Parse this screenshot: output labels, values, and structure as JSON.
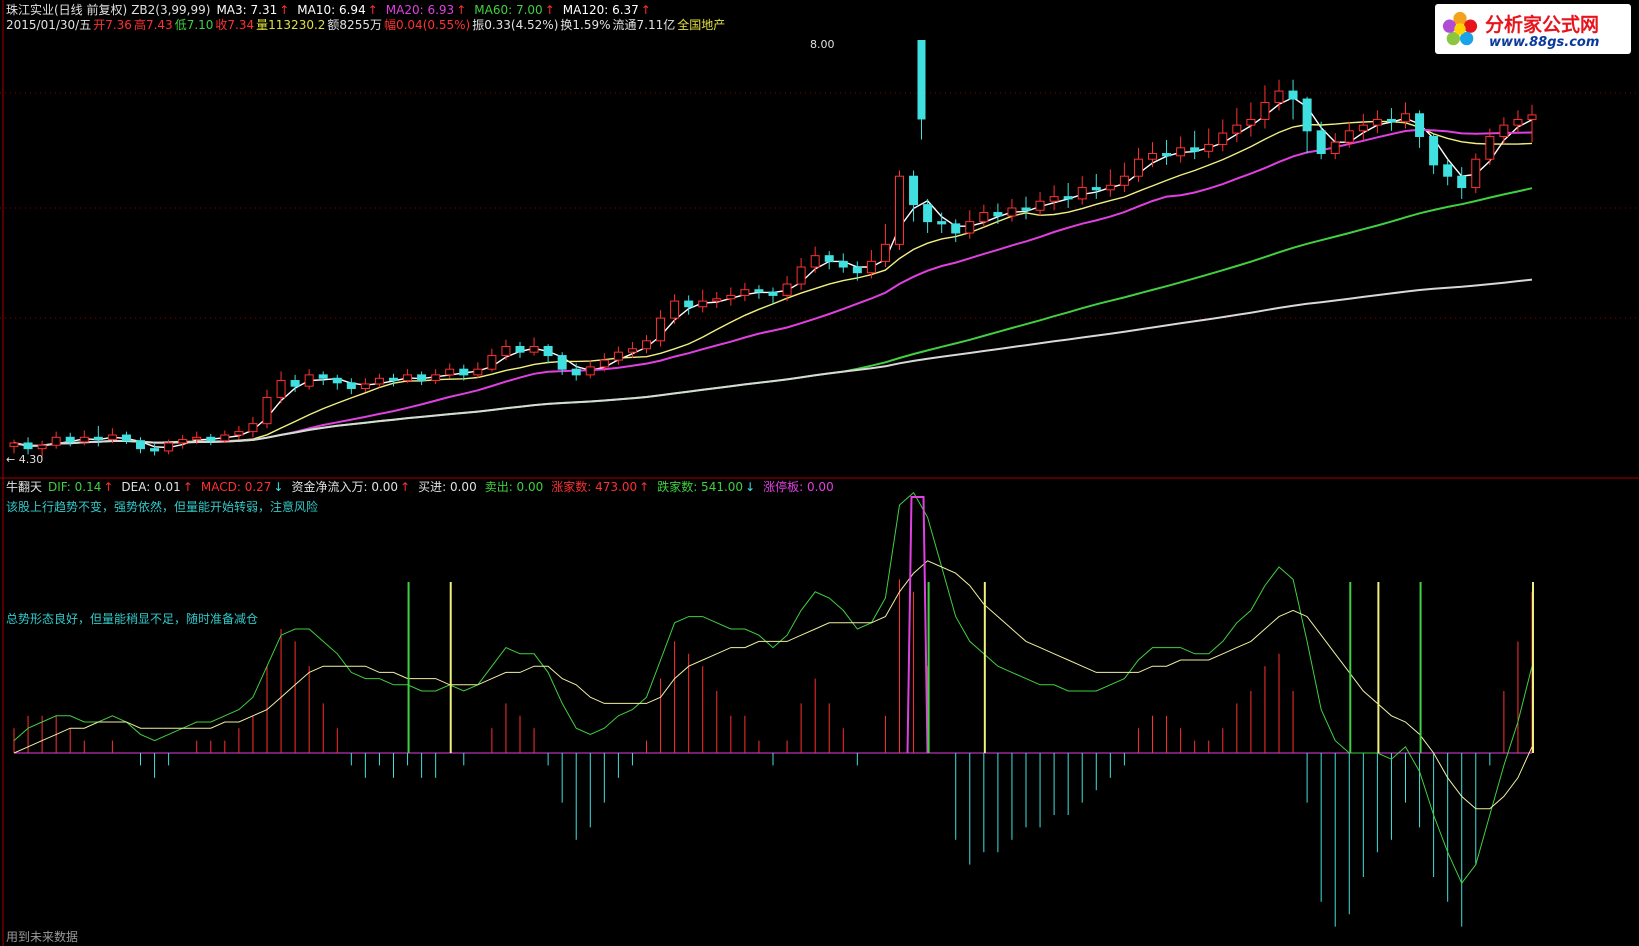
{
  "header": {
    "title": "珠江实业(日线 前复权)",
    "formula": "ZB2(3,99,99)",
    "ma": [
      {
        "label": "MA3: 7.31",
        "color": "#ffffff"
      },
      {
        "label": "MA10: 6.94",
        "color": "#ffffff"
      },
      {
        "label": "MA20: 6.93",
        "color": "#e040e0"
      },
      {
        "label": "MA60: 7.00",
        "color": "#40d040"
      },
      {
        "label": "MA120: 6.37",
        "color": "#ffffff"
      }
    ],
    "up_arrow": "↑",
    "down_arrow": "↓"
  },
  "quote": {
    "date": "2015/01/30/五",
    "open": "开7.36",
    "high": "高7.43",
    "low": "低7.10",
    "close": "收7.34",
    "volume": "量113230.2",
    "amount": "额8255万",
    "change": "幅0.04(0.55%)",
    "amplitude": "振0.33(4.52%)",
    "turnover": "换1.59%",
    "float": "流通7.11亿",
    "sector": "全国地产"
  },
  "price_labels": {
    "high_label": "8.00",
    "low_label": "← 4.30"
  },
  "indicator": {
    "name": "牛翻天",
    "items": [
      {
        "label": "DIF: 0.14",
        "color": "#40d040",
        "arrow": "↑"
      },
      {
        "label": "DEA: 0.01",
        "color": "#e0e0e0",
        "arrow": "↑"
      },
      {
        "label": "MACD: 0.27",
        "color": "#ff3030",
        "arrow": "↓"
      },
      {
        "label": "资金净流入万: 0.00",
        "color": "#e0e0e0",
        "arrow": "↑"
      },
      {
        "label": "买进: 0.00",
        "color": "#e0e0e0",
        "arrow": ""
      },
      {
        "label": "卖出: 0.00",
        "color": "#40d040",
        "arrow": ""
      },
      {
        "label": "涨家数: 473.00",
        "color": "#ff3030",
        "arrow": "↑"
      },
      {
        "label": "跌家数: 541.00",
        "color": "#40d040",
        "arrow": "↓"
      },
      {
        "label": "涨停板: 0.00",
        "color": "#e040e0",
        "arrow": ""
      }
    ],
    "note1": "该股上行趋势不变，强势依然，但量能开始转弱，注意风险",
    "note2": "总势形态良好，但量能稍显不足，随时准备减仓"
  },
  "footer": {
    "text": "用到未来数据"
  },
  "logo": {
    "name": "分析家公式网",
    "url": "www.88gs.com"
  },
  "colors": {
    "up": "#ff3030",
    "down": "#40e0e0",
    "ma_white": "#ffffff",
    "ma_yellow": "#f0f080",
    "ma_magenta": "#e040e0",
    "ma_green": "#40d040",
    "ma_gray": "#d8d8d8",
    "grid": "#8b0000"
  },
  "chart_data": {
    "type": "candlestick",
    "price_range": [
      4.3,
      8.0
    ],
    "candles": [
      [
        4.42,
        4.45,
        4.36,
        4.48
      ],
      [
        4.45,
        4.4,
        4.35,
        4.5
      ],
      [
        4.4,
        4.43,
        4.33,
        4.47
      ],
      [
        4.43,
        4.5,
        4.4,
        4.55
      ],
      [
        4.5,
        4.46,
        4.42,
        4.54
      ],
      [
        4.46,
        4.5,
        4.43,
        4.56
      ],
      [
        4.5,
        4.48,
        4.42,
        4.6
      ],
      [
        4.48,
        4.52,
        4.45,
        4.58
      ],
      [
        4.52,
        4.47,
        4.44,
        4.55
      ],
      [
        4.47,
        4.4,
        4.36,
        4.5
      ],
      [
        4.4,
        4.38,
        4.34,
        4.44
      ],
      [
        4.38,
        4.45,
        4.35,
        4.48
      ],
      [
        4.45,
        4.48,
        4.4,
        4.52
      ],
      [
        4.48,
        4.5,
        4.44,
        4.55
      ],
      [
        4.5,
        4.47,
        4.43,
        4.53
      ],
      [
        4.47,
        4.52,
        4.45,
        4.56
      ],
      [
        4.52,
        4.55,
        4.48,
        4.6
      ],
      [
        4.55,
        4.62,
        4.5,
        4.68
      ],
      [
        4.62,
        4.85,
        4.58,
        4.92
      ],
      [
        4.85,
        5.0,
        4.8,
        5.08
      ],
      [
        5.0,
        4.95,
        4.9,
        5.05
      ],
      [
        4.95,
        5.05,
        4.92,
        5.1
      ],
      [
        5.05,
        5.02,
        4.96,
        5.08
      ],
      [
        5.02,
        4.98,
        4.92,
        5.05
      ],
      [
        4.98,
        4.93,
        4.88,
        5.02
      ],
      [
        4.93,
        4.97,
        4.9,
        5.02
      ],
      [
        4.97,
        5.02,
        4.94,
        5.06
      ],
      [
        5.02,
        5.0,
        4.95,
        5.06
      ],
      [
        5.0,
        5.05,
        4.98,
        5.1
      ],
      [
        5.05,
        5.0,
        4.96,
        5.08
      ],
      [
        5.0,
        5.05,
        4.97,
        5.1
      ],
      [
        5.05,
        5.1,
        5.02,
        5.15
      ],
      [
        5.1,
        5.05,
        5.0,
        5.14
      ],
      [
        5.05,
        5.1,
        5.02,
        5.16
      ],
      [
        5.1,
        5.22,
        5.08,
        5.28
      ],
      [
        5.22,
        5.3,
        5.18,
        5.36
      ],
      [
        5.3,
        5.25,
        5.2,
        5.34
      ],
      [
        5.25,
        5.3,
        5.22,
        5.38
      ],
      [
        5.3,
        5.22,
        5.15,
        5.32
      ],
      [
        5.22,
        5.1,
        5.05,
        5.25
      ],
      [
        5.1,
        5.05,
        5.0,
        5.15
      ],
      [
        5.05,
        5.12,
        5.02,
        5.18
      ],
      [
        5.12,
        5.18,
        5.08,
        5.24
      ],
      [
        5.18,
        5.25,
        5.14,
        5.3
      ],
      [
        5.25,
        5.28,
        5.2,
        5.34
      ],
      [
        5.28,
        5.35,
        5.24,
        5.4
      ],
      [
        5.35,
        5.55,
        5.3,
        5.62
      ],
      [
        5.55,
        5.7,
        5.5,
        5.76
      ],
      [
        5.7,
        5.65,
        5.58,
        5.75
      ],
      [
        5.65,
        5.7,
        5.6,
        5.8
      ],
      [
        5.7,
        5.72,
        5.64,
        5.78
      ],
      [
        5.72,
        5.75,
        5.66,
        5.82
      ],
      [
        5.75,
        5.8,
        5.7,
        5.86
      ],
      [
        5.8,
        5.78,
        5.72,
        5.84
      ],
      [
        5.78,
        5.75,
        5.68,
        5.82
      ],
      [
        5.75,
        5.85,
        5.7,
        5.92
      ],
      [
        5.85,
        6.0,
        5.8,
        6.08
      ],
      [
        6.0,
        6.1,
        5.95,
        6.18
      ],
      [
        6.1,
        6.05,
        5.98,
        6.14
      ],
      [
        6.05,
        6.0,
        5.95,
        6.12
      ],
      [
        6.0,
        5.95,
        5.88,
        6.05
      ],
      [
        5.95,
        6.05,
        5.9,
        6.15
      ],
      [
        6.05,
        6.2,
        6.0,
        6.38
      ],
      [
        6.2,
        6.8,
        6.15,
        6.85
      ],
      [
        6.8,
        6.55,
        6.4,
        6.85
      ],
      [
        6.55,
        6.4,
        6.3,
        6.6
      ],
      [
        6.4,
        6.38,
        6.3,
        6.48
      ],
      [
        6.38,
        6.3,
        6.22,
        6.42
      ],
      [
        6.3,
        6.4,
        6.25,
        6.5
      ],
      [
        6.4,
        6.48,
        6.35,
        6.55
      ],
      [
        6.48,
        6.45,
        6.38,
        6.56
      ],
      [
        6.45,
        6.52,
        6.4,
        6.6
      ],
      [
        6.52,
        6.5,
        6.42,
        6.62
      ],
      [
        6.5,
        6.58,
        6.45,
        6.66
      ],
      [
        6.58,
        6.62,
        6.5,
        6.72
      ],
      [
        6.62,
        6.6,
        6.52,
        6.74
      ],
      [
        6.6,
        6.7,
        6.55,
        6.8
      ],
      [
        6.7,
        6.68,
        6.6,
        6.82
      ],
      [
        6.68,
        6.72,
        6.62,
        6.86
      ],
      [
        6.72,
        6.8,
        6.66,
        6.92
      ],
      [
        6.8,
        6.95,
        6.75,
        7.05
      ],
      [
        6.95,
        7.0,
        6.88,
        7.1
      ],
      [
        7.0,
        6.98,
        6.9,
        7.12
      ],
      [
        6.98,
        7.05,
        6.92,
        7.15
      ],
      [
        7.05,
        7.02,
        6.95,
        7.2
      ],
      [
        7.02,
        7.08,
        6.96,
        7.22
      ],
      [
        7.08,
        7.18,
        7.02,
        7.3
      ],
      [
        7.18,
        7.25,
        7.1,
        7.4
      ],
      [
        7.25,
        7.3,
        7.15,
        7.45
      ],
      [
        7.3,
        7.45,
        7.22,
        7.6
      ],
      [
        7.45,
        7.55,
        7.38,
        7.65
      ],
      [
        7.55,
        7.48,
        7.3,
        7.65
      ],
      [
        7.48,
        7.2,
        7.0,
        7.5
      ],
      [
        7.2,
        7.0,
        6.95,
        7.28
      ],
      [
        7.0,
        7.1,
        6.95,
        7.18
      ],
      [
        7.1,
        7.2,
        7.05,
        7.28
      ],
      [
        7.2,
        7.25,
        7.12,
        7.35
      ],
      [
        7.25,
        7.3,
        7.18,
        7.38
      ],
      [
        7.3,
        7.28,
        7.2,
        7.4
      ],
      [
        7.28,
        7.35,
        7.22,
        7.45
      ],
      [
        7.35,
        7.15,
        7.05,
        7.38
      ],
      [
        7.15,
        6.9,
        6.82,
        7.18
      ],
      [
        6.9,
        6.8,
        6.72,
        6.95
      ],
      [
        6.8,
        6.7,
        6.6,
        6.88
      ],
      [
        6.7,
        6.95,
        6.65,
        7.0
      ],
      [
        6.95,
        7.15,
        6.9,
        7.22
      ],
      [
        7.15,
        7.25,
        7.08,
        7.32
      ],
      [
        7.25,
        7.3,
        7.18,
        7.38
      ],
      [
        7.3,
        7.34,
        7.1,
        7.43
      ]
    ],
    "event_marker": {
      "index": 63,
      "open": 6.95,
      "close": 8.0,
      "low": 7.3,
      "high": 8.0
    },
    "ma_series": [
      {
        "name": "MA3",
        "color": "#ffffff"
      },
      {
        "name": "MA10",
        "color": "#f0f080"
      },
      {
        "name": "MA20",
        "color": "#e040e0"
      },
      {
        "name": "MA60",
        "color": "#40d040"
      },
      {
        "name": "MA120",
        "color": "#d8d8d8"
      }
    ],
    "indicator_series": {
      "dif": [
        0.02,
        0.04,
        0.05,
        0.06,
        0.06,
        0.05,
        0.05,
        0.06,
        0.05,
        0.03,
        0.02,
        0.03,
        0.04,
        0.05,
        0.05,
        0.06,
        0.07,
        0.09,
        0.14,
        0.19,
        0.2,
        0.2,
        0.18,
        0.16,
        0.13,
        0.12,
        0.12,
        0.11,
        0.11,
        0.1,
        0.1,
        0.11,
        0.1,
        0.11,
        0.14,
        0.17,
        0.16,
        0.16,
        0.13,
        0.08,
        0.04,
        0.03,
        0.04,
        0.06,
        0.07,
        0.09,
        0.15,
        0.21,
        0.22,
        0.22,
        0.21,
        0.2,
        0.2,
        0.19,
        0.17,
        0.19,
        0.23,
        0.26,
        0.25,
        0.23,
        0.2,
        0.21,
        0.25,
        0.4,
        0.42,
        0.38,
        0.3,
        0.22,
        0.18,
        0.16,
        0.14,
        0.13,
        0.12,
        0.11,
        0.11,
        0.1,
        0.1,
        0.1,
        0.11,
        0.12,
        0.15,
        0.17,
        0.17,
        0.17,
        0.16,
        0.16,
        0.18,
        0.21,
        0.23,
        0.27,
        0.3,
        0.28,
        0.18,
        0.07,
        0.02,
        0.0,
        0.0,
        0.0,
        -0.01,
        0.01,
        -0.03,
        -0.1,
        -0.16,
        -0.21,
        -0.18,
        -0.1,
        -0.02,
        0.05,
        0.14
      ],
      "dea": [
        0.0,
        0.01,
        0.02,
        0.03,
        0.04,
        0.04,
        0.05,
        0.05,
        0.05,
        0.04,
        0.04,
        0.04,
        0.04,
        0.04,
        0.04,
        0.05,
        0.05,
        0.06,
        0.07,
        0.09,
        0.11,
        0.13,
        0.14,
        0.14,
        0.14,
        0.14,
        0.13,
        0.13,
        0.12,
        0.12,
        0.12,
        0.11,
        0.11,
        0.11,
        0.12,
        0.13,
        0.13,
        0.14,
        0.14,
        0.12,
        0.11,
        0.09,
        0.08,
        0.08,
        0.08,
        0.08,
        0.09,
        0.12,
        0.14,
        0.15,
        0.16,
        0.17,
        0.17,
        0.18,
        0.18,
        0.18,
        0.19,
        0.2,
        0.21,
        0.21,
        0.21,
        0.21,
        0.22,
        0.26,
        0.29,
        0.31,
        0.3,
        0.29,
        0.27,
        0.24,
        0.22,
        0.2,
        0.18,
        0.17,
        0.16,
        0.15,
        0.14,
        0.13,
        0.13,
        0.13,
        0.13,
        0.14,
        0.14,
        0.15,
        0.15,
        0.15,
        0.16,
        0.17,
        0.18,
        0.2,
        0.22,
        0.23,
        0.22,
        0.19,
        0.16,
        0.13,
        0.1,
        0.08,
        0.06,
        0.05,
        0.03,
        0.0,
        -0.04,
        -0.07,
        -0.09,
        -0.09,
        -0.07,
        -0.04,
        0.01
      ]
    }
  }
}
